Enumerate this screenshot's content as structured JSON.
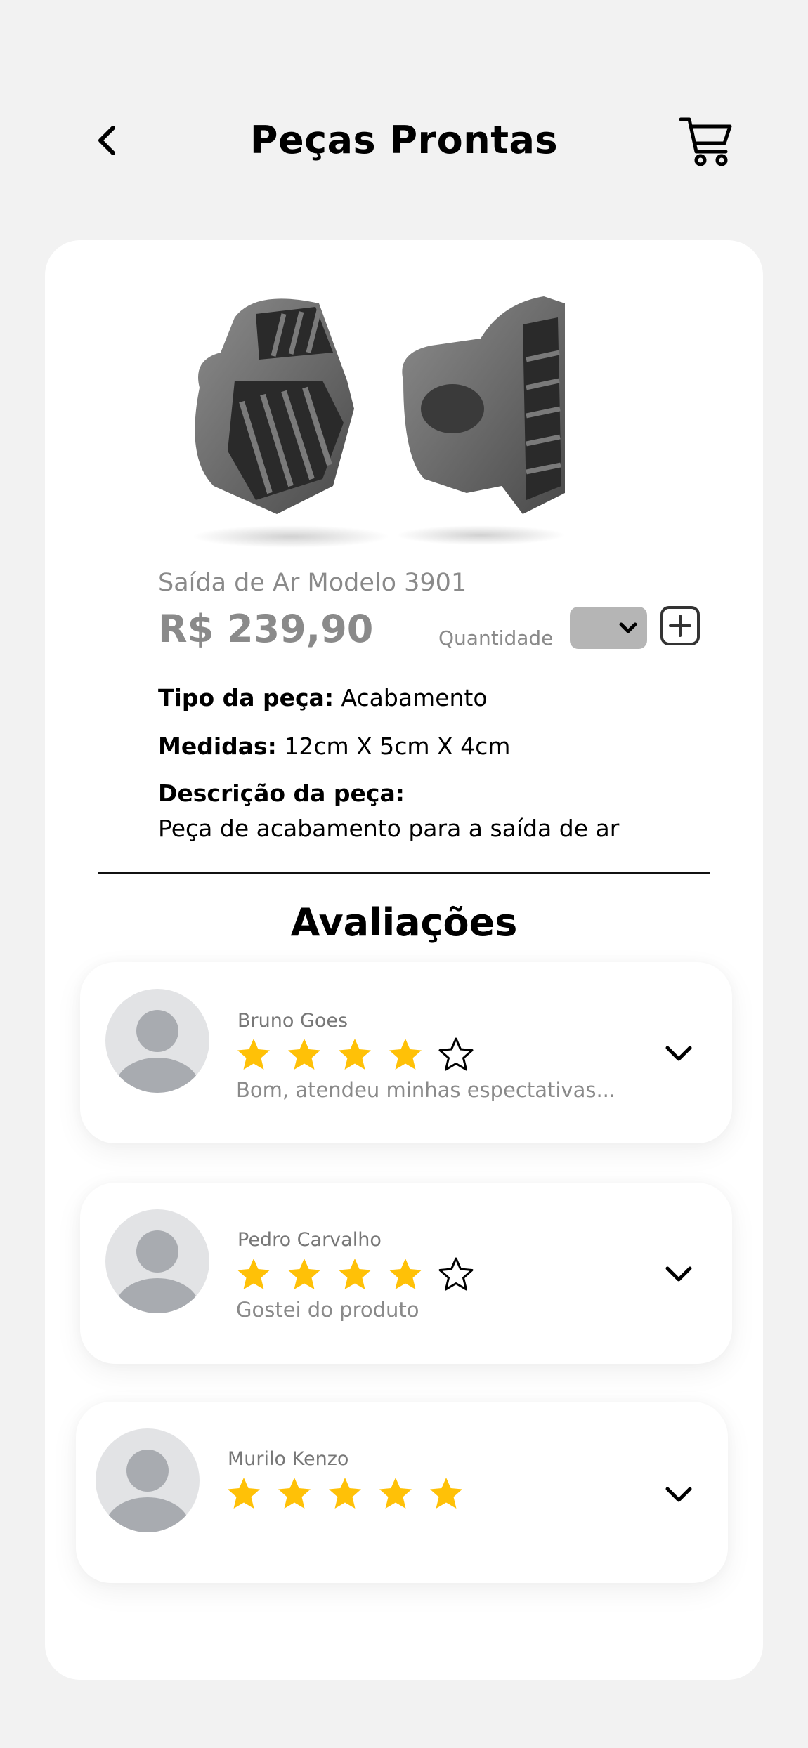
{
  "header": {
    "title": "Peças Prontas",
    "back_icon": "chevron-left-icon",
    "cart_icon": "cart-icon"
  },
  "product": {
    "name": "Saída de Ar Modelo 3901",
    "price": "R$ 239,90",
    "quantity_label": "Quantidade",
    "type_label": "Tipo da peça:",
    "type_value": "Acabamento",
    "measures_label": "Medidas:",
    "measures_value": "12cm X 5cm X 4cm",
    "description_label": "Descrição da peça:",
    "description_value": "Peça de acabamento para a saída de ar"
  },
  "reviews": {
    "title": "Avaliações",
    "items": [
      {
        "name": "Bruno Goes",
        "rating": 4,
        "comment": "Bom, atendeu minhas espectativas..."
      },
      {
        "name": "Pedro Carvalho",
        "rating": 4,
        "comment": "Gostei do produto"
      },
      {
        "name": "Murilo Kenzo",
        "rating": 5,
        "comment": ""
      }
    ]
  },
  "colors": {
    "background": "#f2f2f2",
    "card": "#ffffff",
    "star": "#ffc107",
    "muted_text": "#8a8a8a",
    "select_bg": "#b5b5b5"
  }
}
